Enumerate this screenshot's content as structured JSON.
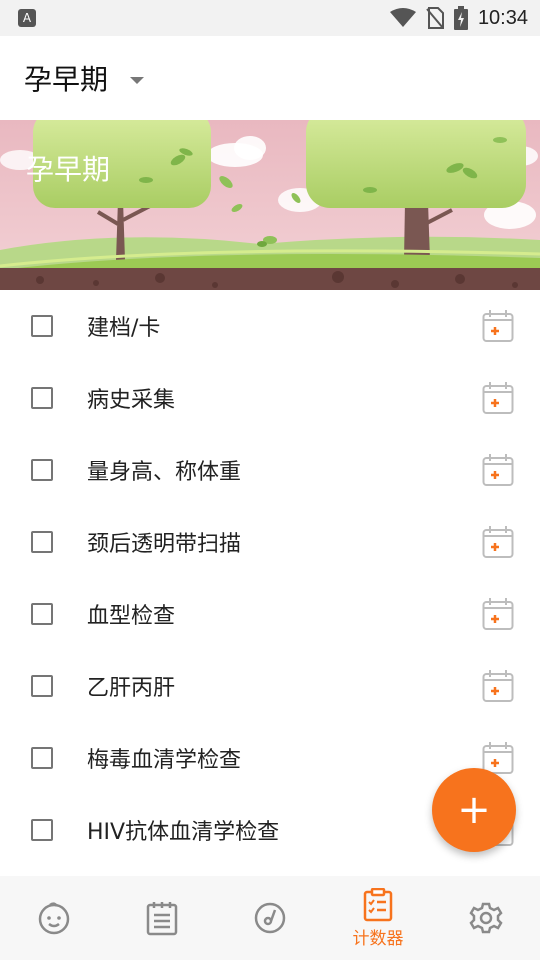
{
  "status": {
    "time": "10:34",
    "left_icon": "A"
  },
  "header": {
    "title": "孕早期"
  },
  "banner": {
    "title": "孕早期"
  },
  "items": [
    {
      "label": "建档/卡"
    },
    {
      "label": "病史采集"
    },
    {
      "label": "量身高、称体重"
    },
    {
      "label": "颈后透明带扫描"
    },
    {
      "label": "血型检查"
    },
    {
      "label": "乙肝丙肝"
    },
    {
      "label": "梅毒血清学检查"
    },
    {
      "label": "HIV抗体血清学检查"
    }
  ],
  "fab": {
    "symbol": "+"
  },
  "bottom_nav": {
    "items": [
      {
        "icon": "baby-face-icon",
        "label": ""
      },
      {
        "icon": "notebook-icon",
        "label": ""
      },
      {
        "icon": "music-disc-icon",
        "label": ""
      },
      {
        "icon": "checklist-icon",
        "label": "计数器",
        "active": true
      },
      {
        "icon": "gear-icon",
        "label": ""
      }
    ]
  },
  "colors": {
    "accent": "#f7731d"
  }
}
